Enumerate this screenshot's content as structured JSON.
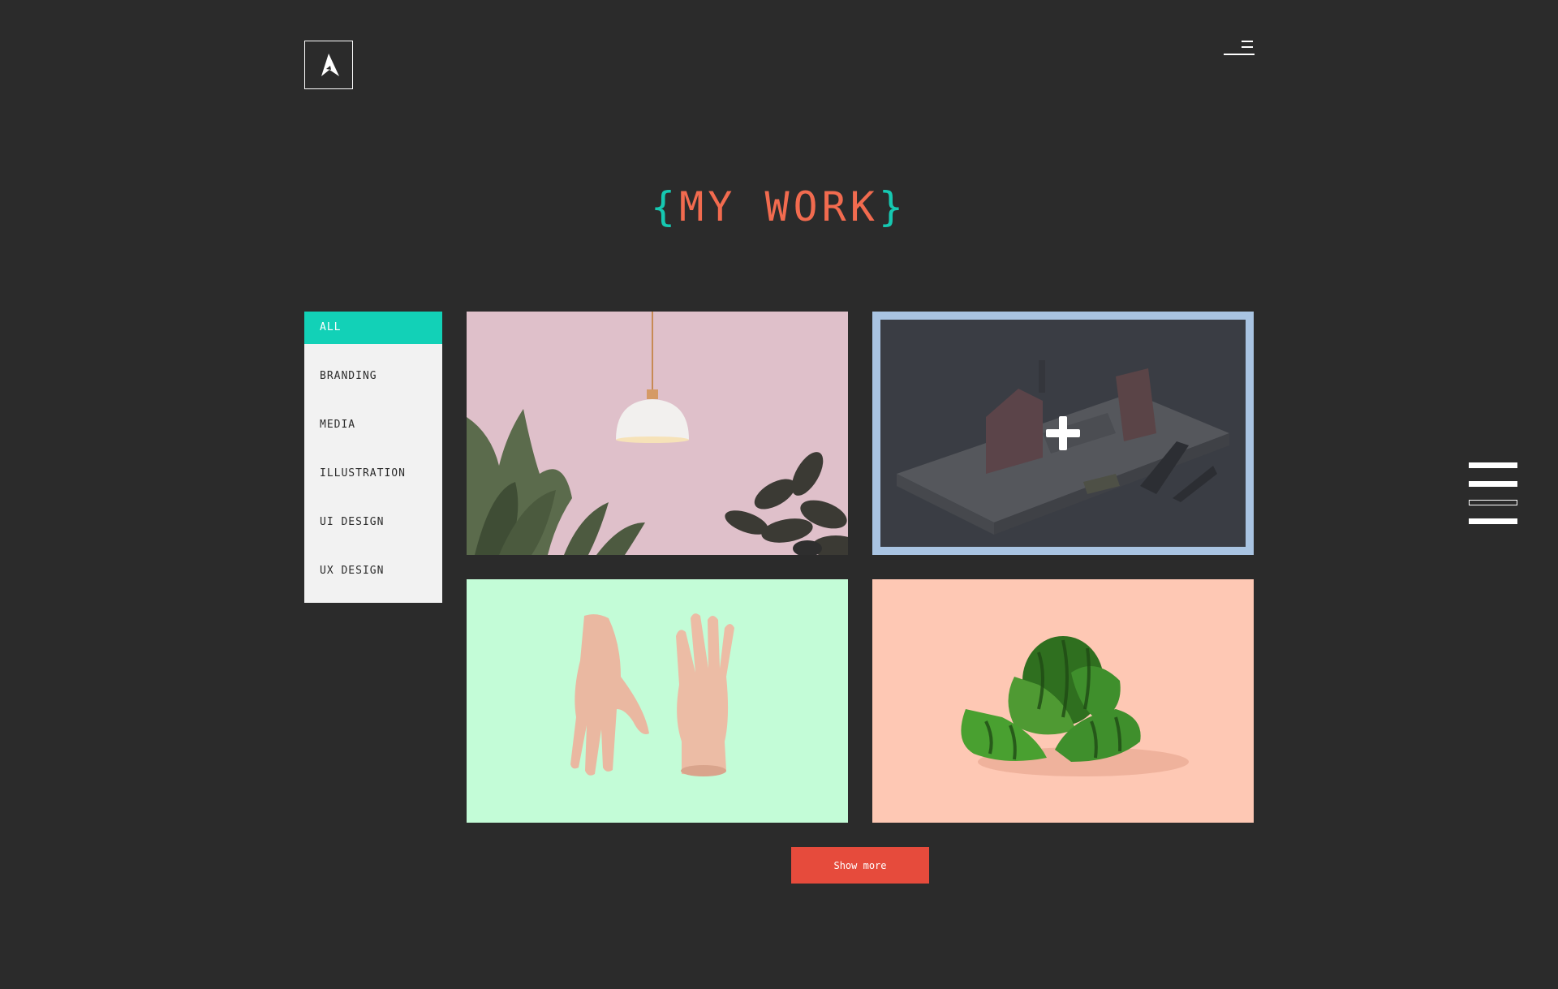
{
  "header": {
    "logo_icon": "a-logo-icon",
    "menu_icon": "menu-icon"
  },
  "title": {
    "open_brace": "{",
    "text": "MY WORK",
    "close_brace": "}"
  },
  "filters": [
    {
      "label": "ALL",
      "active": true
    },
    {
      "label": "BRANDING",
      "active": false
    },
    {
      "label": "MEDIA",
      "active": false
    },
    {
      "label": "ILLUSTRATION",
      "active": false
    },
    {
      "label": "UI DESIGN",
      "active": false
    },
    {
      "label": "UX DESIGN",
      "active": false
    }
  ],
  "portfolio": {
    "items": [
      {
        "image": "pendant-lamp-plants",
        "bg": "#e0c1cb"
      },
      {
        "image": "paper-house-model",
        "bg": "#3a3d44",
        "overlay_icon": "plus-icon",
        "frame": "#a9c4e2"
      },
      {
        "image": "mannequin-hands",
        "bg": "#c3fcd7"
      },
      {
        "image": "watermelon-slices",
        "bg": "#fec8b4"
      }
    ]
  },
  "actions": {
    "show_more_label": "Show more"
  },
  "side_nav": {
    "icon": "side-menu-icon"
  },
  "colors": {
    "background": "#2b2b2b",
    "accent_teal": "#12d1b7",
    "accent_coral": "#f26b4f",
    "button_red": "#e64b3c",
    "filter_bg": "#f2f2f2"
  }
}
